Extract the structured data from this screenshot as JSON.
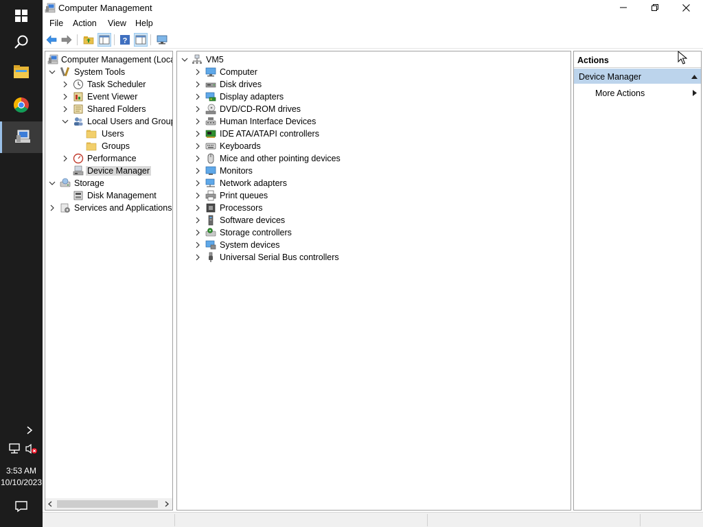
{
  "window": {
    "title": "Computer Management"
  },
  "menu": [
    "File",
    "Action",
    "View",
    "Help"
  ],
  "tree": {
    "root": "Computer Management (Local",
    "system_tools": "System Tools",
    "task_scheduler": "Task Scheduler",
    "event_viewer": "Event Viewer",
    "shared_folders": "Shared Folders",
    "local_users_groups": "Local Users and Groups",
    "users": "Users",
    "groups": "Groups",
    "performance": "Performance",
    "device_manager": "Device Manager",
    "storage": "Storage",
    "disk_management": "Disk Management",
    "services_apps": "Services and Applications"
  },
  "devices": {
    "root": "VM5",
    "categories": [
      "Computer",
      "Disk drives",
      "Display adapters",
      "DVD/CD-ROM drives",
      "Human Interface Devices",
      "IDE ATA/ATAPI controllers",
      "Keyboards",
      "Mice and other pointing devices",
      "Monitors",
      "Network adapters",
      "Print queues",
      "Processors",
      "Software devices",
      "Storage controllers",
      "System devices",
      "Universal Serial Bus controllers"
    ]
  },
  "actions": {
    "header": "Actions",
    "section": "Device Manager",
    "more": "More Actions"
  },
  "taskbar": {
    "time": "3:53 AM",
    "date": "10/10/2023"
  },
  "colors": {
    "taskbar": "#1c1c1c",
    "selection": "#d9d9d9",
    "action_section": "#bcd4ec"
  }
}
